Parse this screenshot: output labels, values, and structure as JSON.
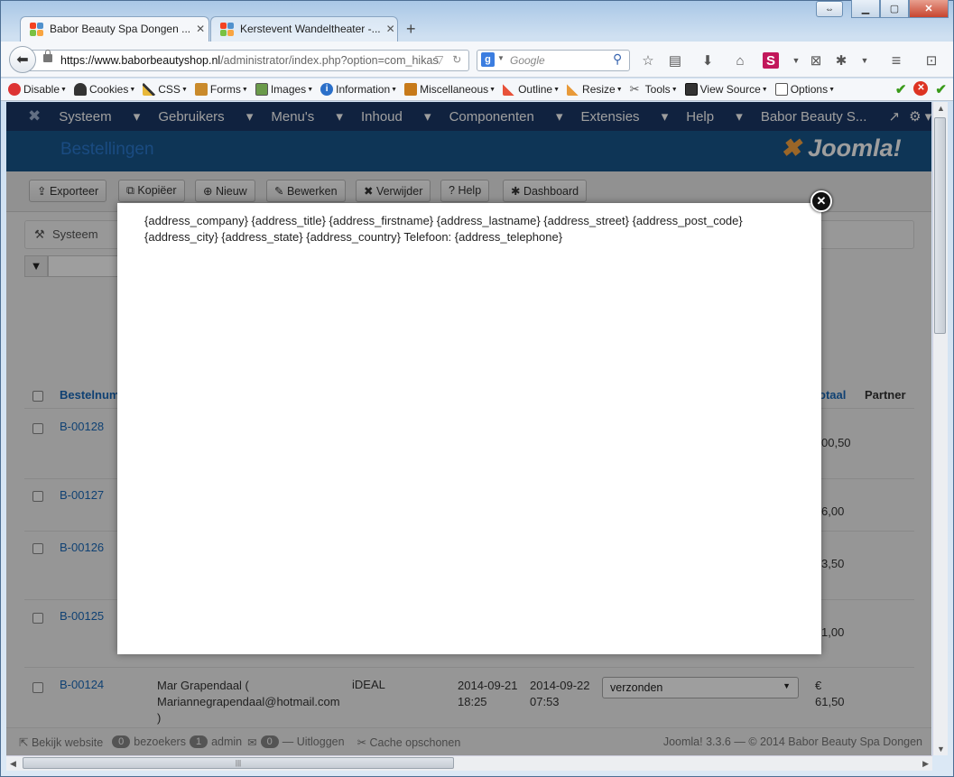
{
  "window": {
    "tabs": [
      {
        "title": "Babor Beauty Spa Dongen ...",
        "close": "✕"
      },
      {
        "title": "Kerstevent Wandeltheater -...",
        "close": "✕"
      }
    ],
    "new_tab": "+"
  },
  "nav": {
    "url_host": "https://www.baborbeautyshop.nl",
    "url_path": "/administrator/index.php?option=com_hikas",
    "search_engine_icon": "google-icon",
    "search_placeholder": "Google"
  },
  "devtoolbar": {
    "items": [
      "Disable",
      "Cookies",
      "CSS",
      "Forms",
      "Images",
      "Information",
      "Miscellaneous",
      "Outline",
      "Resize",
      "Tools",
      "View Source",
      "Options"
    ]
  },
  "joomla": {
    "menu": [
      "Systeem",
      "Gebruikers",
      "Menu's",
      "Inhoud",
      "Componenten",
      "Extensies",
      "Help"
    ],
    "site_name": "Babor Beauty S...",
    "page_title": "Bestellingen",
    "logo_text": "Joomla!",
    "toolbar": [
      "Exporteer",
      "Kopiëer",
      "Nieuw",
      "Bewerken",
      "Verwijder",
      "Help",
      "Dashboard"
    ],
    "submenu_label": "Systeem",
    "columns": {
      "order": "Bestelnum",
      "total": "otaal",
      "partner": "Partner"
    },
    "rows": [
      {
        "id": "B-00128",
        "total": "00,50"
      },
      {
        "id": "B-00127",
        "total": "6,00"
      },
      {
        "id": "B-00126",
        "total": "3,50"
      },
      {
        "id": "B-00125",
        "total": "1,00"
      },
      {
        "id": "B-00124",
        "customer": [
          "Mar Grapendaal (",
          "Mariannegrapendaal@hotmail.com",
          ")"
        ],
        "payment": "iDEAL",
        "created": [
          "2014-09-21",
          "18:25"
        ],
        "modified": [
          "2014-09-22",
          "07:53"
        ],
        "status": "verzonden",
        "total": [
          "€",
          "61,50"
        ]
      }
    ],
    "status": {
      "view_site": "Bekijk website",
      "visitors_count": "0",
      "visitors_label": "bezoekers",
      "admin_count": "1",
      "admin_label": "admin",
      "messages_count": "0",
      "logout": "Uitloggen",
      "cache": "Cache opschonen",
      "footer": "Joomla! 3.3.6 — © 2014 Babor Beauty Spa Dongen"
    }
  },
  "modal": {
    "line1": "{address_company} {address_title} {address_firstname} {address_lastname} {address_street} {address_post_code}",
    "line2": "{address_city} {address_state} {address_country} Telefoon: {address_telephone}",
    "close": "✕"
  }
}
